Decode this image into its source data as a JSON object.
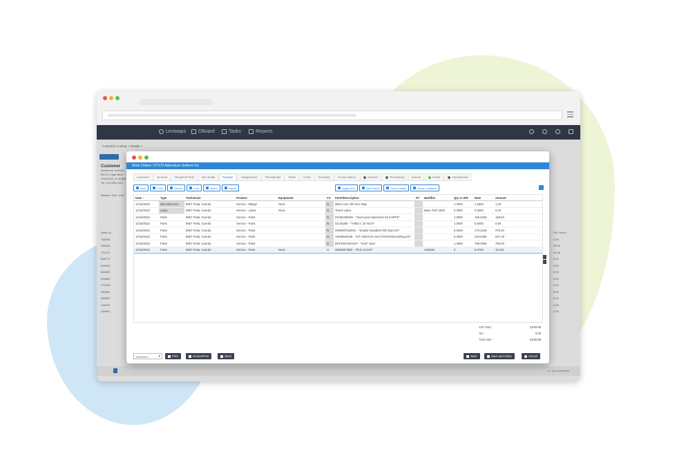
{
  "nav": {
    "items": [
      "Leviwaps",
      "DBoard",
      "Tasks",
      "Reports"
    ]
  },
  "background": {
    "tab": "Customer Lookup  ×  Details  ×",
    "customer_heading": "Customer",
    "customer_lines": [
      "Adventure Uniform",
      "900 N. Cage Blvd",
      "CHICAGO, IL 60654",
      "Tel: 312-555-1212"
    ],
    "balance_label": "Balance Due: 0.00",
    "left_col": [
      "Work Or..",
      "768195",
      "768340",
      "737272",
      "638774",
      "619616",
      "568490",
      "549862",
      "270152",
      "349862",
      "569862",
      "145679",
      "348981"
    ],
    "right_col": [
      "Est. Hours",
      "2.00",
      "40.00",
      "91.00",
      "0.00",
      "0.00",
      "0.00",
      "0.00",
      "2.00",
      "0.00",
      "0.00",
      "0.00",
      "2.00"
    ],
    "pager_count": "1 - 10 of 15 items"
  },
  "modal": {
    "title": "Work Orders 737272 Adventure Uniform Inc",
    "tabs": [
      {
        "label": "Customer"
      },
      {
        "label": "General"
      },
      {
        "label": "Required Parts"
      },
      {
        "label": "Est. Detail"
      },
      {
        "label": "Register",
        "active": true
      },
      {
        "label": "Assignments"
      },
      {
        "label": "Timestamps"
      },
      {
        "label": "Tasks"
      },
      {
        "label": "Costs"
      },
      {
        "label": "Inventory"
      },
      {
        "label": "Invoice Memo"
      },
      {
        "label": "Invoices",
        "dot": "#666666"
      },
      {
        "label": "Purchasing",
        "dot": "#666666"
      },
      {
        "label": "Events"
      },
      {
        "label": "Notes",
        "dot": "#5fba55"
      },
      {
        "label": "Attachments",
        "dot": "#666666"
      }
    ],
    "toolbar_left": [
      "New",
      "Form",
      "Delete",
      "Cost",
      "Notes",
      "Import"
    ],
    "toolbar_right": [
      "Apply Item",
      "Add Parcel",
      "Parts Details",
      "Show Locations"
    ],
    "columns": [
      "Date ↑",
      "Type",
      "Technician",
      "Product",
      "Equipment",
      "CV",
      "Part#/Description",
      "P#",
      "Modifier",
      "Qty or S/N",
      "Rate",
      "Amount"
    ],
    "rows": [
      [
        "12/16/2022",
        "Miscellaneous",
        "8957 Tesla, Guerda",
        "Service - Milage",
        "None",
        "N",
        "Mileu-over 100 One Way",
        "",
        "",
        "1.0000",
        "1.2500",
        "1.25"
      ],
      [
        "12/16/2022",
        "Labor",
        "8957 Tesla, Guerda",
        "Service - Labor",
        "None",
        "N",
        "Travel Labor",
        "",
        "Base Tech 2000",
        "0.0000",
        "0.0000",
        "0.00"
      ],
      [
        "12/16/2022",
        "Parts",
        "8957 Tesla, Guerda",
        "Service - Parts",
        "",
        "N",
        "PE4842560DI - \"Seal Laser Machined 34.5 HPFE\"",
        "",
        "",
        "1.0000",
        "158.5329",
        "158.53"
      ],
      [
        "12/16/2022",
        "Parts",
        "8957 Tesla, Guerda",
        "Service - Parts",
        "",
        "N",
        "GC4E300 - \"V-BELT, 20 INCH\"",
        "",
        "",
        "1.0000",
        "5.5000",
        "5.50"
      ],
      [
        "12/16/2022",
        "Parts",
        "8957 Tesla, Guerda",
        "Service - Parts",
        "",
        "N",
        "DW9087018001 - \"Double Deadbolt Old Style.DIY\"",
        "",
        "",
        "6.0000",
        "176.2159",
        "976.30"
      ],
      [
        "12/16/2022",
        "Parts",
        "8957 Tesla, Guerda",
        "Service - Parts",
        "",
        "N",
        "AW40664236 - \"KIT SMOOTH SUCTION/Reduce/Ring,Kit\"",
        "",
        "",
        "6.0000",
        "104.5295",
        "627.18"
      ],
      [
        "12/16/2022",
        "Parts",
        "8957 Tesla, Guerda",
        "Service - Parts",
        "",
        "N",
        "BCPO6470OOLP - \"Knut\" Stud",
        "",
        "",
        "1.0000",
        "799.3586",
        "799.36"
      ]
    ],
    "edit_row": [
      "12/16/2022",
      "Parts",
      "8957 Tesla, Guerda",
      "Service - Parts",
      "None",
      "N",
      "GE860970B0 - \"PAIL CHAIN\"",
      "",
      "Variable",
      "3",
      "5.0720",
      "113.52"
    ],
    "totals": [
      {
        "label": "Sub Total :",
        "value": "2,640.59"
      },
      {
        "label": "Tax :",
        "value": "0.00"
      },
      {
        "label": "Total Sale :",
        "value": "2,640.59"
      }
    ],
    "footer": {
      "dropdown": "DEFAULT",
      "print": "Print",
      "invoice_post": "Invoice/Post",
      "send": "Send",
      "save": "Save",
      "save_close": "Save and Close",
      "cancel": "Cancel"
    }
  }
}
